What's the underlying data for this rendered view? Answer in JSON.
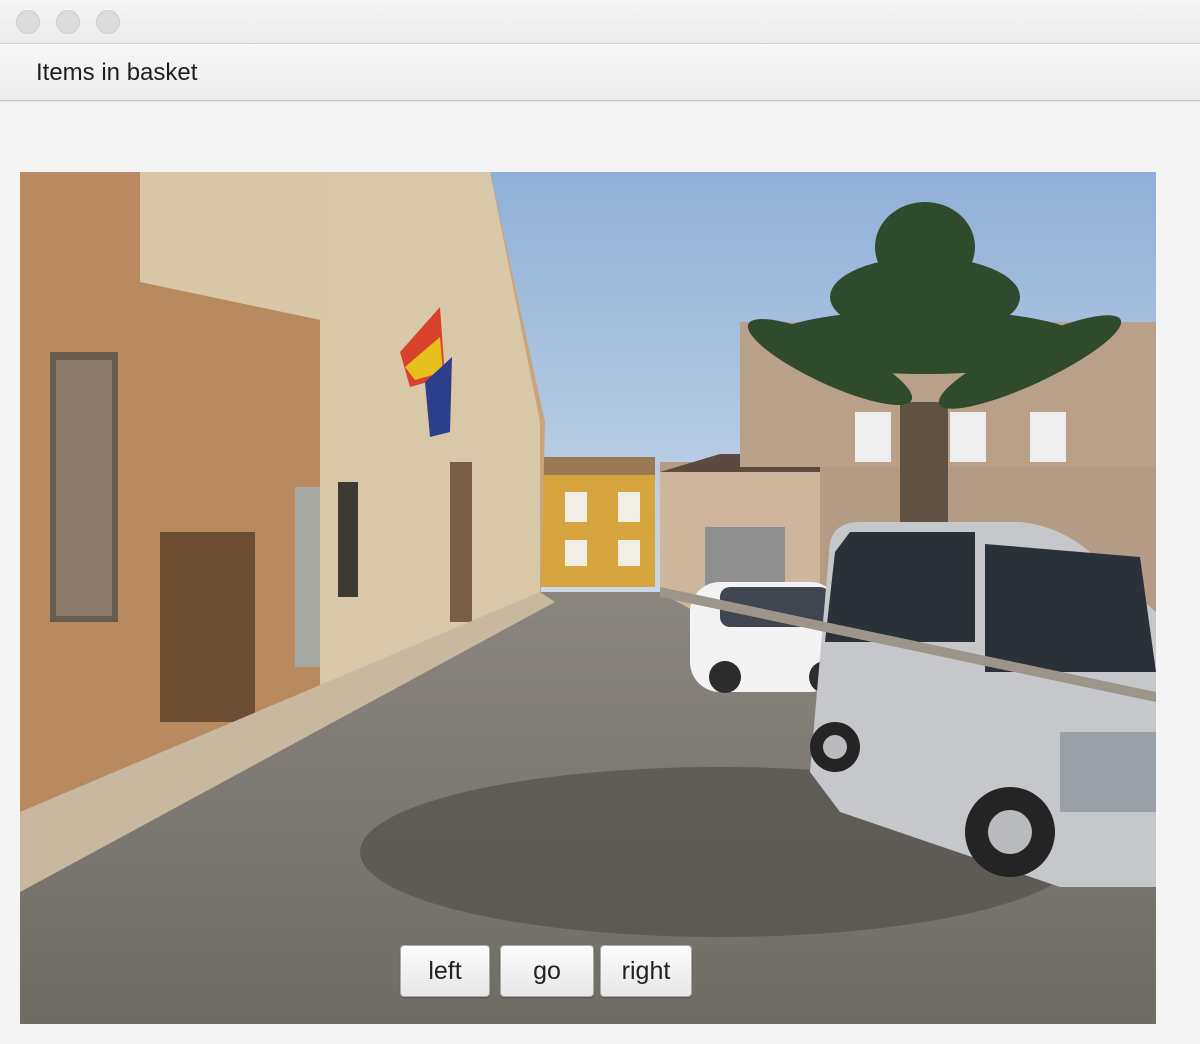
{
  "window": {
    "title_label": "Items in basket"
  },
  "image": {
    "description_icon": "street-photo-image"
  },
  "controls": {
    "left_label": "left",
    "go_label": "go",
    "right_label": "right"
  }
}
